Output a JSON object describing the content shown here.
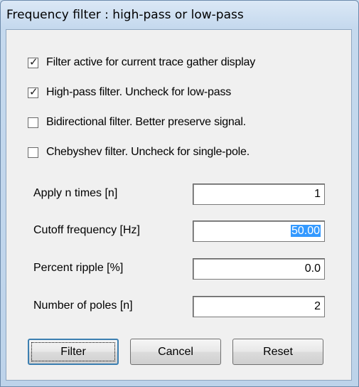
{
  "dialog": {
    "title": "Frequency filter : high-pass or low-pass"
  },
  "options": [
    {
      "label": "Filter active for current trace gather display",
      "checked": true
    },
    {
      "label": "High-pass filter. Uncheck for low-pass",
      "checked": true
    },
    {
      "label": "Bidirectional filter. Better preserve signal.",
      "checked": false
    },
    {
      "label": "Chebyshev filter. Uncheck for single-pole.",
      "checked": false
    }
  ],
  "fields": {
    "apply_n_times": {
      "label": "Apply n times [n]",
      "value": "1"
    },
    "cutoff_frequency": {
      "label": "Cutoff frequency [Hz]",
      "value": "50.00"
    },
    "percent_ripple": {
      "label": "Percent ripple [%]",
      "value": "0.0"
    },
    "number_of_poles": {
      "label": "Number of poles [n]",
      "value": "2"
    }
  },
  "buttons": {
    "filter": "Filter",
    "cancel": "Cancel",
    "reset": "Reset"
  }
}
